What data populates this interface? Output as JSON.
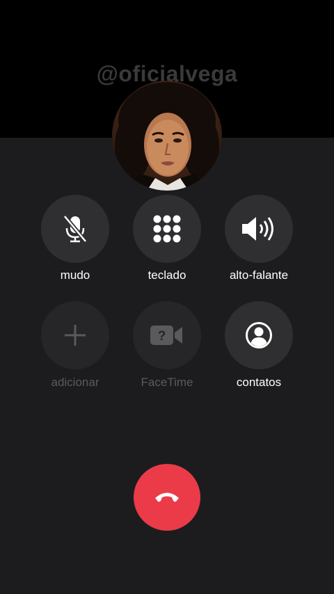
{
  "watermark": "@oficialvega",
  "contact": {
    "avatar": "portrait-photo"
  },
  "controls": [
    {
      "label": "mudo",
      "icon": "mute-icon",
      "enabled": true
    },
    {
      "label": "teclado",
      "icon": "keypad-icon",
      "enabled": true
    },
    {
      "label": "alto-falante",
      "icon": "speaker-icon",
      "enabled": true
    },
    {
      "label": "adicionar",
      "icon": "plus-icon",
      "enabled": false
    },
    {
      "label": "FaceTime",
      "icon": "facetime-icon",
      "enabled": false
    },
    {
      "label": "contatos",
      "icon": "contacts-icon",
      "enabled": true
    }
  ],
  "end_call": {
    "icon": "phone-hangup-icon",
    "color": "#eb3b48"
  },
  "colors": {
    "background": "#1c1c1e",
    "button": "#2f2f31",
    "disabled_text": "#5a5a5c"
  }
}
